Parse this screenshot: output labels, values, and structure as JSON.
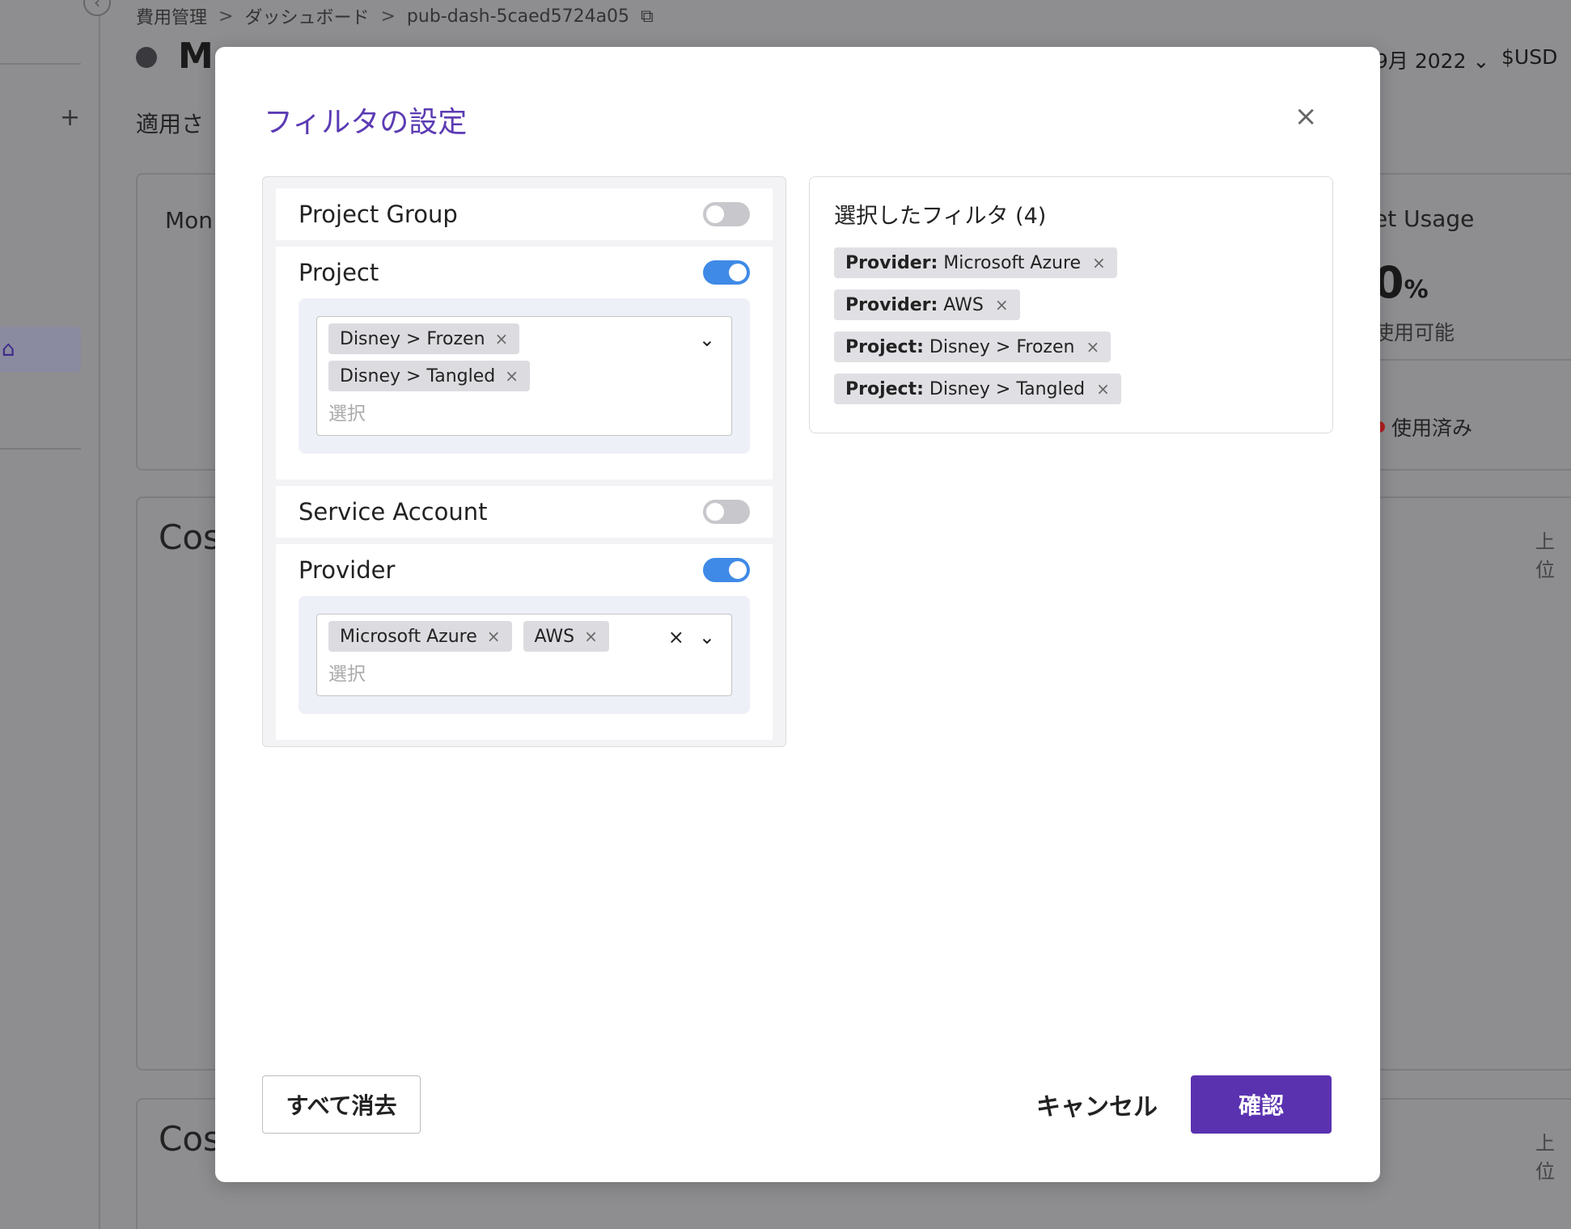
{
  "background": {
    "breadcrumb": [
      "費用管理",
      "ダッシュボード",
      "pub-dash-5caed5724a05"
    ],
    "breadcrumb_separator": ">",
    "page_title": "M",
    "date_selector": "9月 2022",
    "currency_selector": "$USD",
    "applied_filters_label": "適用さ",
    "card1_title": "Mon",
    "card2_title": "Cos",
    "card3_title": "Cos",
    "budget_usage_label": "et Usage",
    "budget_usage_value": "0",
    "budget_usage_unit": "%",
    "available_label": "使用可能",
    "used_label": "使用済み",
    "top_label_1": "上位",
    "top_label_2": "上位",
    "plus_glyph": "+",
    "collapse_glyph": "‹"
  },
  "modal": {
    "title": "フィルタの設定",
    "close_glyph": "×",
    "sections": [
      {
        "label": "Project Group",
        "enabled": false
      },
      {
        "label": "Project",
        "enabled": true,
        "tags": [
          "Disney > Frozen",
          "Disney > Tangled"
        ],
        "placeholder": "選択"
      },
      {
        "label": "Service Account",
        "enabled": false
      },
      {
        "label": "Provider",
        "enabled": true,
        "tags": [
          "Microsoft Azure",
          "AWS"
        ],
        "placeholder": "選択"
      }
    ],
    "selected": {
      "title": "選択したフィルタ (4)",
      "chips": [
        {
          "key": "Provider:",
          "value": "Microsoft Azure"
        },
        {
          "key": "Provider:",
          "value": "AWS"
        },
        {
          "key": "Project:",
          "value": "Disney > Frozen"
        },
        {
          "key": "Project:",
          "value": "Disney > Tangled"
        }
      ]
    },
    "tag_remove_glyph": "×",
    "chevron_glyph": "⌄",
    "clear_glyph": "×",
    "buttons": {
      "clear_all": "すべて消去",
      "cancel": "キャンセル",
      "confirm": "確認"
    }
  },
  "colors": {
    "accent": "#5a32b0",
    "toggle_on": "#3f8ae6",
    "title": "#5b3bb3"
  }
}
